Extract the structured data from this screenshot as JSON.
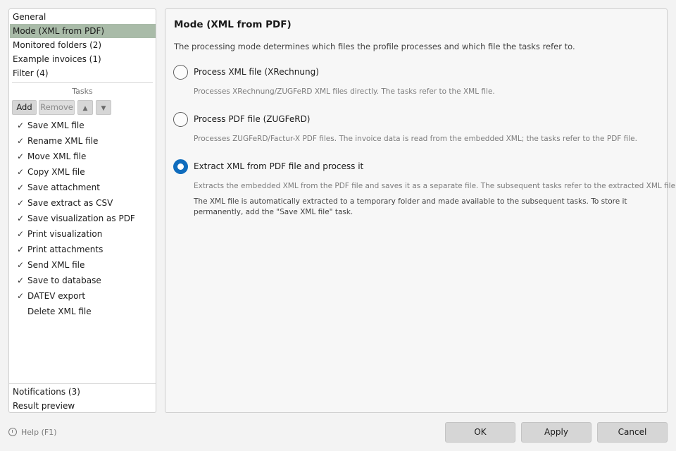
{
  "sidebar": {
    "items": [
      {
        "label": "General"
      },
      {
        "label": "Mode (XML from PDF)",
        "selected": true
      },
      {
        "label": "Monitored folders (2)"
      },
      {
        "label": "Example invoices (1)"
      },
      {
        "label": "Filter (4)"
      }
    ],
    "tasks_header": "Tasks",
    "toolbar": {
      "add_label": "Add",
      "remove_label": "Remove",
      "up_icon": "triangle-up-icon",
      "down_icon": "triangle-down-icon"
    },
    "tasks": [
      {
        "label": "Save XML file",
        "checked": true
      },
      {
        "label": "Rename XML file",
        "checked": true
      },
      {
        "label": "Move XML file",
        "checked": true
      },
      {
        "label": "Copy XML file",
        "checked": true
      },
      {
        "label": "Save attachment",
        "checked": true
      },
      {
        "label": "Save extract as CSV",
        "checked": true
      },
      {
        "label": "Save visualization as PDF",
        "checked": true
      },
      {
        "label": "Print visualization",
        "checked": true
      },
      {
        "label": "Print attachments",
        "checked": true
      },
      {
        "label": "Send XML file",
        "checked": true
      },
      {
        "label": "Save to database",
        "checked": true
      },
      {
        "label": "DATEV export",
        "checked": true
      },
      {
        "label": "Delete XML file",
        "checked": false
      }
    ],
    "check_mark": "✓",
    "bottom_items": [
      {
        "label": "Notifications (3)"
      },
      {
        "label": "Result preview"
      }
    ]
  },
  "main": {
    "title": "Mode (XML from PDF)",
    "description": "The processing mode determines which files the profile processes and which file the tasks refer to.",
    "options": [
      {
        "label": "Process XML file (XRechnung)",
        "description": "Processes XRechnung/ZUGFeRD XML files directly. The tasks refer to the XML file.",
        "selected": false
      },
      {
        "label": "Process PDF file (ZUGFeRD)",
        "description": "Processes ZUGFeRD/Factur-X PDF files. The invoice data is read from the embedded XML; the tasks refer to the PDF file.",
        "selected": false
      },
      {
        "label": "Extract XML from PDF file and process it",
        "description": "Extracts the embedded XML from the PDF file and saves it as a separate file. The subsequent tasks refer to the extracted XML file.",
        "note": "The XML file is automatically extracted to a temporary folder and made available to the subsequent tasks. To store it permanently, add the \"Save XML file\" task.",
        "selected": true
      }
    ]
  },
  "footer": {
    "help_label": "Help (F1)",
    "ok_label": "OK",
    "apply_label": "Apply",
    "cancel_label": "Cancel"
  },
  "colors": {
    "selected_nav": "#a9bba8",
    "radio_accent": "#0f6cbd",
    "button_bg": "#d6d6d6"
  }
}
